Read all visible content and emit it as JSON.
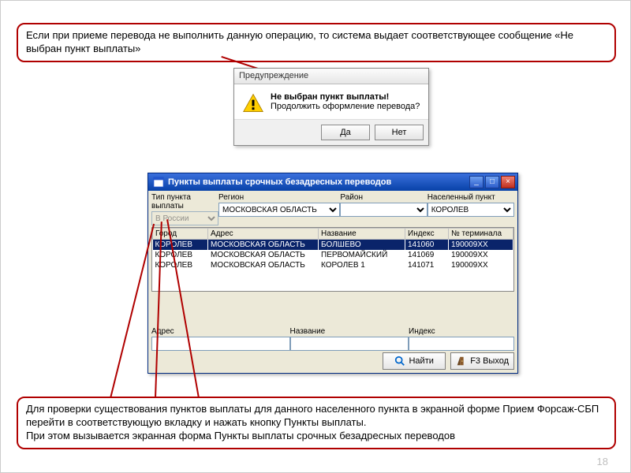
{
  "callouts": {
    "top": "Если при приеме перевода не выполнить данную операцию, то система выдает соответствующее сообщение «Не выбран пункт выплаты»",
    "bottom": "Для проверки существования пунктов выплаты для данного населенного пункта в экранной форме Прием Форсаж-СБП перейти в соответствующую вкладку и нажать кнопку Пункты выплаты.\nПри этом вызывается экранная форма Пункты выплаты срочных безадресных переводов"
  },
  "messagebox": {
    "title": "Предупреждение",
    "bold_line": "Не выбран пункт выплаты!",
    "line2": "Продолжить оформление перевода?",
    "yes": "Да",
    "no": "Нет"
  },
  "paypoints_window": {
    "title": "Пункты выплаты срочных безадресных переводов",
    "filters": {
      "type_label": "Тип пункта выплаты",
      "type_value": "В России",
      "region_label": "Регион",
      "region_value": "МОСКОВСКАЯ ОБЛАСТЬ",
      "district_label": "Район",
      "district_value": "",
      "locality_label": "Населенный пункт",
      "locality_value": "КОРОЛЕВ"
    },
    "columns": [
      "Город",
      "Адрес",
      "Название",
      "Индекс",
      "№ терминала"
    ],
    "rows": [
      {
        "city": "КОРОЛЕВ",
        "addr": "МОСКОВСКАЯ ОБЛАСТЬ",
        "name": "БОЛШЕВО",
        "index": "141060",
        "term": "190009XX",
        "sel": true
      },
      {
        "city": "КОРОЛЕВ",
        "addr": "МОСКОВСКАЯ ОБЛАСТЬ",
        "name": "ПЕРВОМАЙСКИЙ",
        "index": "141069",
        "term": "190009XX",
        "sel": false
      },
      {
        "city": "КОРОЛЕВ",
        "addr": "МОСКОВСКАЯ ОБЛАСТЬ",
        "name": "КОРОЛЕВ 1",
        "index": "141071",
        "term": "190009XX",
        "sel": false
      }
    ],
    "bottom_inputs": {
      "addr_label": "Адрес",
      "name_label": "Название",
      "index_label": "Индекс"
    },
    "search_btn": "Найти",
    "exit_btn": "F3 Выход"
  },
  "page_number": "18"
}
